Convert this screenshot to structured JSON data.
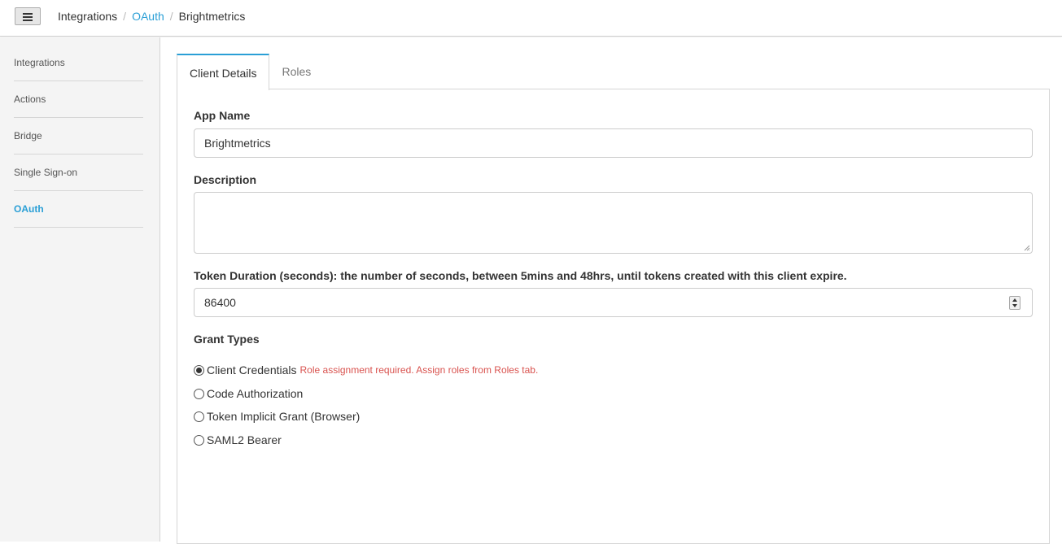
{
  "topbar": {
    "menu_icon": "hamburger-icon",
    "breadcrumb": {
      "root": "Integrations",
      "parent": "OAuth",
      "current": "Brightmetrics",
      "separator": "/"
    }
  },
  "sidebar": {
    "items": [
      {
        "label": "Integrations",
        "active": false
      },
      {
        "label": "Actions",
        "active": false
      },
      {
        "label": "Bridge",
        "active": false
      },
      {
        "label": "Single Sign-on",
        "active": false
      },
      {
        "label": "OAuth",
        "active": true
      }
    ]
  },
  "tabs": [
    {
      "label": "Client Details",
      "active": true
    },
    {
      "label": "Roles",
      "active": false
    }
  ],
  "form": {
    "app_name_label": "App Name",
    "app_name_value": "Brightmetrics",
    "description_label": "Description",
    "description_value": "",
    "token_label": "Token Duration (seconds): the number of seconds, between 5mins and 48hrs, until tokens created with this client expire.",
    "token_value": "86400",
    "grant_types_label": "Grant Types",
    "grant_types": [
      {
        "label": "Client Credentials",
        "checked": true,
        "note": "Role assignment required. Assign roles from Roles tab."
      },
      {
        "label": "Code Authorization",
        "checked": false
      },
      {
        "label": "Token Implicit Grant (Browser)",
        "checked": false
      },
      {
        "label": "SAML2 Bearer",
        "checked": false
      }
    ]
  },
  "colors": {
    "accent": "#2a9fd6",
    "error": "#d9534f",
    "sidebar_bg": "#f4f4f4"
  }
}
